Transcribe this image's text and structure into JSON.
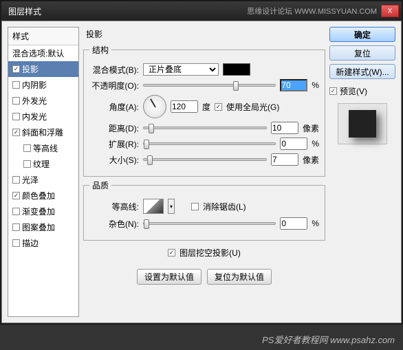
{
  "window": {
    "title": "图层样式",
    "watermark": "思缘设计论坛  WWW.MISSYUAN.COM",
    "close": "X"
  },
  "sidebar": {
    "header": "样式",
    "items": [
      {
        "label": "混合选项:默认",
        "checked": false,
        "hasCb": false
      },
      {
        "label": "投影",
        "checked": true,
        "hasCb": true,
        "selected": true
      },
      {
        "label": "内阴影",
        "checked": false,
        "hasCb": true
      },
      {
        "label": "外发光",
        "checked": false,
        "hasCb": true
      },
      {
        "label": "内发光",
        "checked": false,
        "hasCb": true
      },
      {
        "label": "斜面和浮雕",
        "checked": true,
        "hasCb": true
      },
      {
        "label": "等高线",
        "checked": false,
        "hasCb": true,
        "sub": true
      },
      {
        "label": "纹理",
        "checked": false,
        "hasCb": true,
        "sub": true
      },
      {
        "label": "光泽",
        "checked": false,
        "hasCb": true
      },
      {
        "label": "颜色叠加",
        "checked": true,
        "hasCb": true
      },
      {
        "label": "渐变叠加",
        "checked": false,
        "hasCb": true
      },
      {
        "label": "图案叠加",
        "checked": false,
        "hasCb": true
      },
      {
        "label": "描边",
        "checked": false,
        "hasCb": true
      }
    ]
  },
  "main": {
    "title": "投影",
    "structure": {
      "legend": "结构",
      "blendMode": {
        "label": "混合模式(B):",
        "value": "正片叠底",
        "color": "#000000"
      },
      "opacity": {
        "label": "不透明度(O):",
        "value": "70",
        "unit": "%"
      },
      "angle": {
        "label": "角度(A):",
        "value": "120",
        "unit": "度",
        "globalLight": {
          "label": "使用全局光(G)",
          "checked": true
        }
      },
      "distance": {
        "label": "距离(D):",
        "value": "10",
        "unit": "像素"
      },
      "spread": {
        "label": "扩展(R):",
        "value": "0",
        "unit": "%"
      },
      "size": {
        "label": "大小(S):",
        "value": "7",
        "unit": "像素"
      }
    },
    "quality": {
      "legend": "品质",
      "contour": {
        "label": "等高线:",
        "antialias": {
          "label": "消除锯齿(L)",
          "checked": false
        }
      },
      "noise": {
        "label": "杂色(N):",
        "value": "0",
        "unit": "%"
      }
    },
    "knockout": {
      "label": "图层挖空投影(U)",
      "checked": true
    },
    "defaults": {
      "set": "设置为默认值",
      "reset": "复位为默认值"
    }
  },
  "right": {
    "ok": "确定",
    "cancel": "复位",
    "newStyle": "新建样式(W)...",
    "preview": {
      "label": "预览(V)",
      "checked": true
    }
  },
  "footer": "PS爱好者教程网  www.psahz.com"
}
